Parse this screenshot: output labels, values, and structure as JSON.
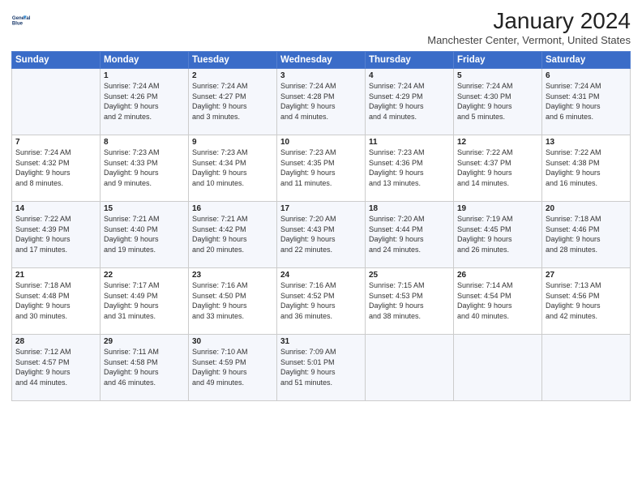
{
  "header": {
    "logo_line1": "General",
    "logo_line2": "Blue",
    "month": "January 2024",
    "location": "Manchester Center, Vermont, United States"
  },
  "days_of_week": [
    "Sunday",
    "Monday",
    "Tuesday",
    "Wednesday",
    "Thursday",
    "Friday",
    "Saturday"
  ],
  "weeks": [
    [
      {
        "day": "",
        "info": ""
      },
      {
        "day": "1",
        "info": "Sunrise: 7:24 AM\nSunset: 4:26 PM\nDaylight: 9 hours\nand 2 minutes."
      },
      {
        "day": "2",
        "info": "Sunrise: 7:24 AM\nSunset: 4:27 PM\nDaylight: 9 hours\nand 3 minutes."
      },
      {
        "day": "3",
        "info": "Sunrise: 7:24 AM\nSunset: 4:28 PM\nDaylight: 9 hours\nand 4 minutes."
      },
      {
        "day": "4",
        "info": "Sunrise: 7:24 AM\nSunset: 4:29 PM\nDaylight: 9 hours\nand 4 minutes."
      },
      {
        "day": "5",
        "info": "Sunrise: 7:24 AM\nSunset: 4:30 PM\nDaylight: 9 hours\nand 5 minutes."
      },
      {
        "day": "6",
        "info": "Sunrise: 7:24 AM\nSunset: 4:31 PM\nDaylight: 9 hours\nand 6 minutes."
      }
    ],
    [
      {
        "day": "7",
        "info": "Sunrise: 7:24 AM\nSunset: 4:32 PM\nDaylight: 9 hours\nand 8 minutes."
      },
      {
        "day": "8",
        "info": "Sunrise: 7:23 AM\nSunset: 4:33 PM\nDaylight: 9 hours\nand 9 minutes."
      },
      {
        "day": "9",
        "info": "Sunrise: 7:23 AM\nSunset: 4:34 PM\nDaylight: 9 hours\nand 10 minutes."
      },
      {
        "day": "10",
        "info": "Sunrise: 7:23 AM\nSunset: 4:35 PM\nDaylight: 9 hours\nand 11 minutes."
      },
      {
        "day": "11",
        "info": "Sunrise: 7:23 AM\nSunset: 4:36 PM\nDaylight: 9 hours\nand 13 minutes."
      },
      {
        "day": "12",
        "info": "Sunrise: 7:22 AM\nSunset: 4:37 PM\nDaylight: 9 hours\nand 14 minutes."
      },
      {
        "day": "13",
        "info": "Sunrise: 7:22 AM\nSunset: 4:38 PM\nDaylight: 9 hours\nand 16 minutes."
      }
    ],
    [
      {
        "day": "14",
        "info": "Sunrise: 7:22 AM\nSunset: 4:39 PM\nDaylight: 9 hours\nand 17 minutes."
      },
      {
        "day": "15",
        "info": "Sunrise: 7:21 AM\nSunset: 4:40 PM\nDaylight: 9 hours\nand 19 minutes."
      },
      {
        "day": "16",
        "info": "Sunrise: 7:21 AM\nSunset: 4:42 PM\nDaylight: 9 hours\nand 20 minutes."
      },
      {
        "day": "17",
        "info": "Sunrise: 7:20 AM\nSunset: 4:43 PM\nDaylight: 9 hours\nand 22 minutes."
      },
      {
        "day": "18",
        "info": "Sunrise: 7:20 AM\nSunset: 4:44 PM\nDaylight: 9 hours\nand 24 minutes."
      },
      {
        "day": "19",
        "info": "Sunrise: 7:19 AM\nSunset: 4:45 PM\nDaylight: 9 hours\nand 26 minutes."
      },
      {
        "day": "20",
        "info": "Sunrise: 7:18 AM\nSunset: 4:46 PM\nDaylight: 9 hours\nand 28 minutes."
      }
    ],
    [
      {
        "day": "21",
        "info": "Sunrise: 7:18 AM\nSunset: 4:48 PM\nDaylight: 9 hours\nand 30 minutes."
      },
      {
        "day": "22",
        "info": "Sunrise: 7:17 AM\nSunset: 4:49 PM\nDaylight: 9 hours\nand 31 minutes."
      },
      {
        "day": "23",
        "info": "Sunrise: 7:16 AM\nSunset: 4:50 PM\nDaylight: 9 hours\nand 33 minutes."
      },
      {
        "day": "24",
        "info": "Sunrise: 7:16 AM\nSunset: 4:52 PM\nDaylight: 9 hours\nand 36 minutes."
      },
      {
        "day": "25",
        "info": "Sunrise: 7:15 AM\nSunset: 4:53 PM\nDaylight: 9 hours\nand 38 minutes."
      },
      {
        "day": "26",
        "info": "Sunrise: 7:14 AM\nSunset: 4:54 PM\nDaylight: 9 hours\nand 40 minutes."
      },
      {
        "day": "27",
        "info": "Sunrise: 7:13 AM\nSunset: 4:56 PM\nDaylight: 9 hours\nand 42 minutes."
      }
    ],
    [
      {
        "day": "28",
        "info": "Sunrise: 7:12 AM\nSunset: 4:57 PM\nDaylight: 9 hours\nand 44 minutes."
      },
      {
        "day": "29",
        "info": "Sunrise: 7:11 AM\nSunset: 4:58 PM\nDaylight: 9 hours\nand 46 minutes."
      },
      {
        "day": "30",
        "info": "Sunrise: 7:10 AM\nSunset: 4:59 PM\nDaylight: 9 hours\nand 49 minutes."
      },
      {
        "day": "31",
        "info": "Sunrise: 7:09 AM\nSunset: 5:01 PM\nDaylight: 9 hours\nand 51 minutes."
      },
      {
        "day": "",
        "info": ""
      },
      {
        "day": "",
        "info": ""
      },
      {
        "day": "",
        "info": ""
      }
    ]
  ]
}
